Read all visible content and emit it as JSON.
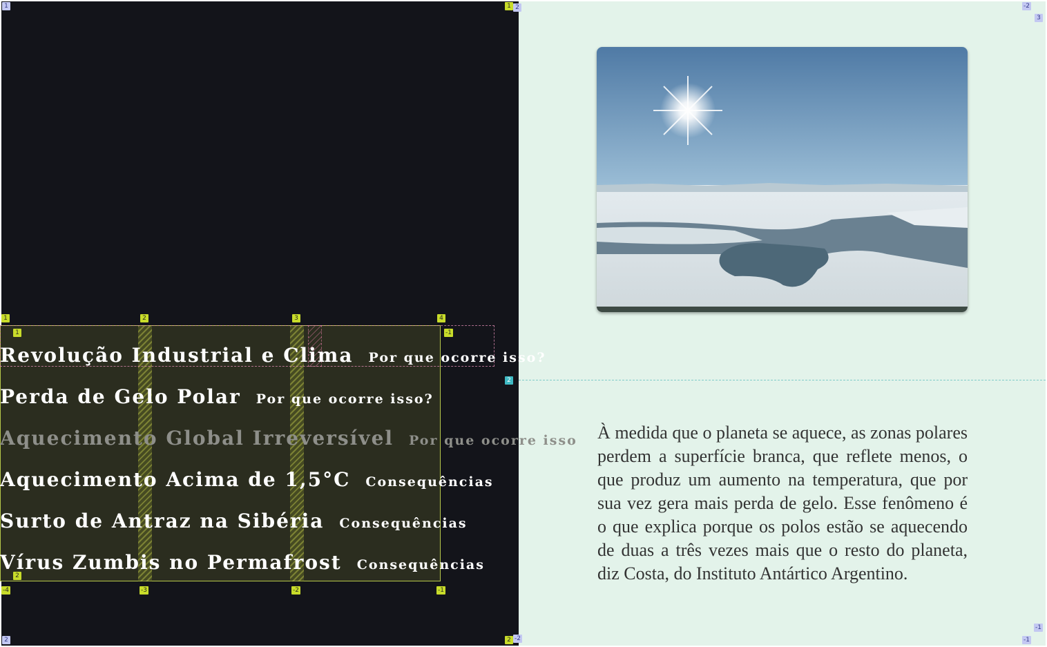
{
  "menu": {
    "rows": [
      {
        "title": "Revolução Industrial e Clima",
        "sub": "Por que ocorre isso?"
      },
      {
        "title": "Perda de Gelo Polar",
        "sub": "Por que ocorre isso?"
      },
      {
        "title": "Aquecimento Global Irreversível",
        "sub": "Por que ocorre isso"
      },
      {
        "title": "Aquecimento Acima de 1,5°C",
        "sub": "Consequências"
      },
      {
        "title": "Surto de Antraz na Sibéria",
        "sub": "Consequências"
      },
      {
        "title": "Vírus Zumbis no Permafrost",
        "sub": "Consequências"
      }
    ]
  },
  "article": {
    "paragraph": "À medida que o planeta se aquece, as zonas polares perdem a superfície branca, que reflete menos, o que produz um aumento na temperatura, que por sua vez gera mais perda de gelo. Esse fenômeno é o que explica porque os polos estão se aquecendo de duas a três vezes mais que o resto do planeta, diz Costa, do Instituto Antártico Argentino."
  },
  "overlay_badges": {
    "grid_col_lines": [
      "1",
      "2",
      "3",
      "4"
    ],
    "grid_col_lines_neg": [
      "-4",
      "-3",
      "-2",
      "-1"
    ],
    "grid_row_lines": [
      "1",
      "2"
    ],
    "grid_row_neg": [
      "-1"
    ],
    "flex_line": "2",
    "page_grid": [
      "1",
      "2",
      "-2",
      "3",
      "-1",
      "2",
      "-2",
      "-1",
      "-1",
      "2",
      "1"
    ]
  },
  "colors": {
    "left_bg": "#13141a",
    "right_bg": "#e3f3ea",
    "grid_overlay": "#c8dc2a",
    "text": "#ffffff",
    "dim_text": "#8e8f8a"
  }
}
